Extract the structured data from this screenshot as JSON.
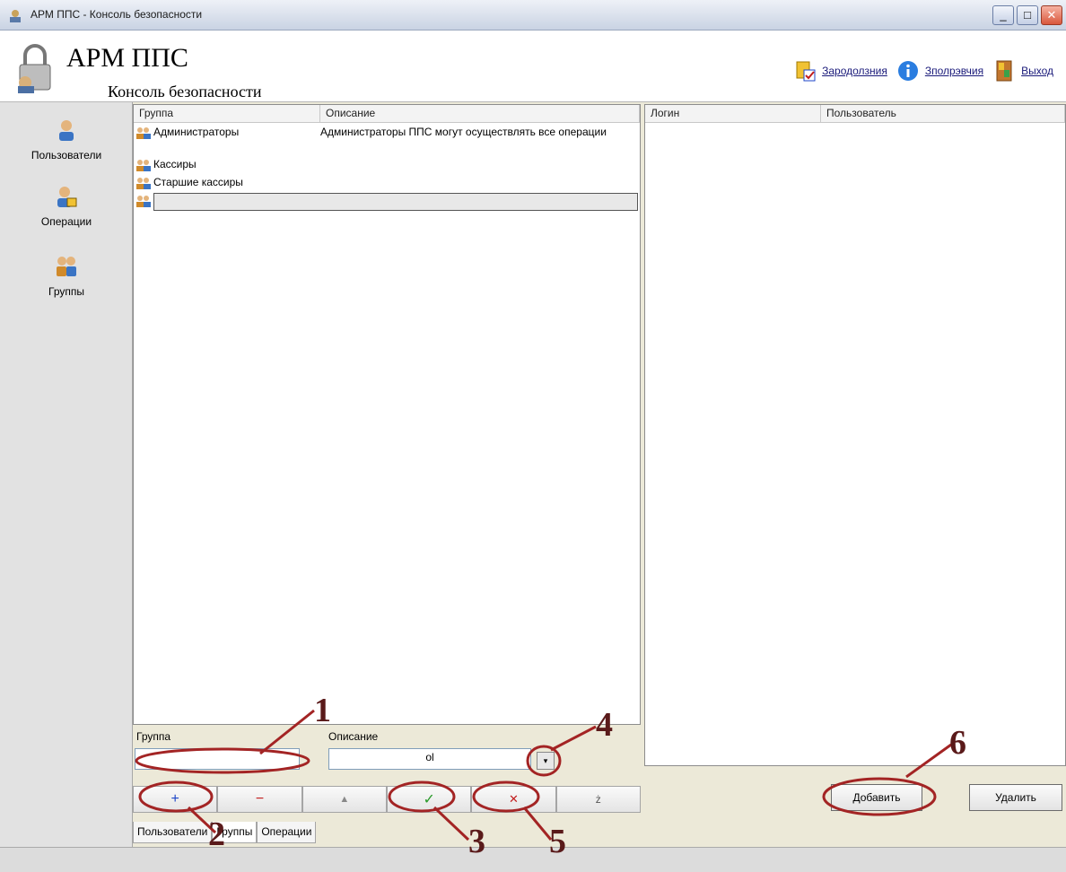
{
  "window": {
    "title": "АРМ ППС - Консоль безопасности"
  },
  "header": {
    "app_title": "АРМ ППС",
    "app_subtitle": "Консоль безопасности",
    "links": [
      {
        "label": "Зародолзния",
        "icon": "task-list-icon"
      },
      {
        "label": "Зполрэвчия",
        "icon": "info-icon"
      },
      {
        "label": "Выход",
        "icon": "exit-door-icon"
      }
    ]
  },
  "sidebar": {
    "items": [
      {
        "label": "Пользователи",
        "icon": "user-icon"
      },
      {
        "label": "Операции",
        "icon": "operation-user-icon"
      },
      {
        "label": "Группы",
        "icon": "group-icon"
      }
    ]
  },
  "groups_table": {
    "columns": [
      "Группа",
      "Описание"
    ],
    "rows": [
      {
        "name": "Администраторы",
        "desc": "Администраторы ППС могут осуществлять все операции"
      },
      {
        "name": "Кассиры",
        "desc": ""
      },
      {
        "name": "Старшие кассиры",
        "desc": ""
      },
      {
        "name": "",
        "desc": ""
      }
    ]
  },
  "right_table": {
    "columns": [
      "Логин",
      "Пользователь"
    ]
  },
  "form": {
    "group_label": "Группа",
    "group_value": "",
    "desc_label": "Описание",
    "desc_value": "ol"
  },
  "toolbar": {
    "add": "+",
    "remove": "−",
    "up": "▲",
    "accept": "✓",
    "cancel": "✕",
    "other": "ż"
  },
  "right_buttons": {
    "add": "Добавить",
    "delete": "Удалить"
  },
  "tabs": [
    "Пользователи",
    "Группы",
    "Операции"
  ],
  "annotations": [
    "1",
    "2",
    "3",
    "4",
    "5",
    "6"
  ],
  "colors": {
    "annotation": "#7a1f1f",
    "accept": "#2a9a2a",
    "cancel": "#c21e1e",
    "add": "#1e46c8",
    "remove": "#c21e1e"
  }
}
